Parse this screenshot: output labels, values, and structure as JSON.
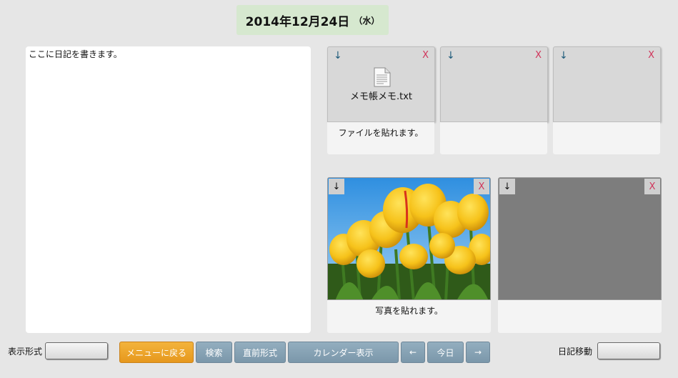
{
  "header": {
    "date": "2014年12月24日",
    "weekday": "（水）"
  },
  "diary": {
    "text": "ここに日記を書きます。"
  },
  "file_slots": [
    {
      "caption": "ファイルを貼れます。",
      "file_name": "メモ帳メモ.txt"
    },
    {
      "caption": "",
      "file_name": ""
    },
    {
      "caption": "",
      "file_name": ""
    }
  ],
  "photo_slots": [
    {
      "caption": "写真を貼れます。"
    },
    {
      "caption": ""
    }
  ],
  "icons": {
    "download": "↓",
    "remove": "X"
  },
  "bottom": {
    "display_mode_label": "表示形式",
    "menu_button": "メニューに戻る",
    "search_button": "検索",
    "recent_button": "直前形式",
    "calendar_button": "カレンダー表示",
    "prev_button": "←",
    "today_button": "今日",
    "next_button": "→",
    "diary_move_label": "日記移動"
  },
  "colors": {
    "accent_orange": "#e6981d",
    "nav_blue": "#7b97aa",
    "date_bg": "#d6e8cf",
    "remove_red": "#d0345a"
  }
}
